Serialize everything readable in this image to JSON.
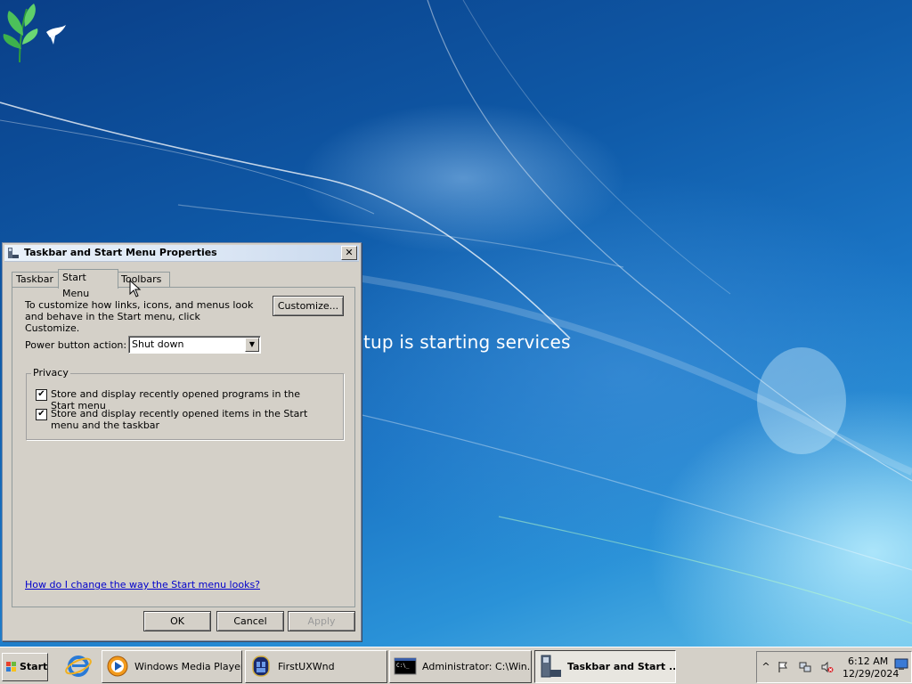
{
  "desktop": {
    "setup_text": "tup is starting services"
  },
  "dialog": {
    "title": "Taskbar and Start Menu Properties",
    "close_label": "✕",
    "tabs": [
      {
        "label": "Taskbar",
        "active": false
      },
      {
        "label": "Start Menu",
        "active": true
      },
      {
        "label": "Toolbars",
        "active": false
      }
    ],
    "description": "To customize how links, icons, and menus look and behave in the Start menu, click Customize.",
    "customize_label": "Customize...",
    "power_button": {
      "label": "Power button action:",
      "value": "Shut down"
    },
    "privacy": {
      "legend": "Privacy",
      "options": [
        {
          "label": "Store and display recently opened programs in the Start menu",
          "checked": true
        },
        {
          "label": "Store and display recently opened items in the Start menu and the taskbar",
          "checked": true
        }
      ]
    },
    "help_link": "How do I change the way the Start menu looks?",
    "buttons": {
      "ok": "OK",
      "cancel": "Cancel",
      "apply": "Apply"
    }
  },
  "taskbar": {
    "start_label": "Start",
    "quick_launch": [
      {
        "icon": "internet-explorer-icon"
      }
    ],
    "tasks": [
      {
        "label": "Windows Media Player",
        "icon": "media-player-icon",
        "active": false
      },
      {
        "label": "FirstUXWnd",
        "icon": "firstux-icon",
        "active": false
      },
      {
        "label": "Administrator: C:\\Win...",
        "icon": "command-prompt-icon",
        "active": false
      },
      {
        "label": "Taskbar and Start ...",
        "icon": "taskbar-properties-icon",
        "active": true
      }
    ],
    "tray": {
      "expand_label": "^",
      "time": "6:12 AM",
      "date": "12/29/2024"
    }
  },
  "colors": {
    "dialog_face": "#d4d0c8",
    "link": "#0000cc",
    "desktop_blue": "#0f5aa8"
  }
}
